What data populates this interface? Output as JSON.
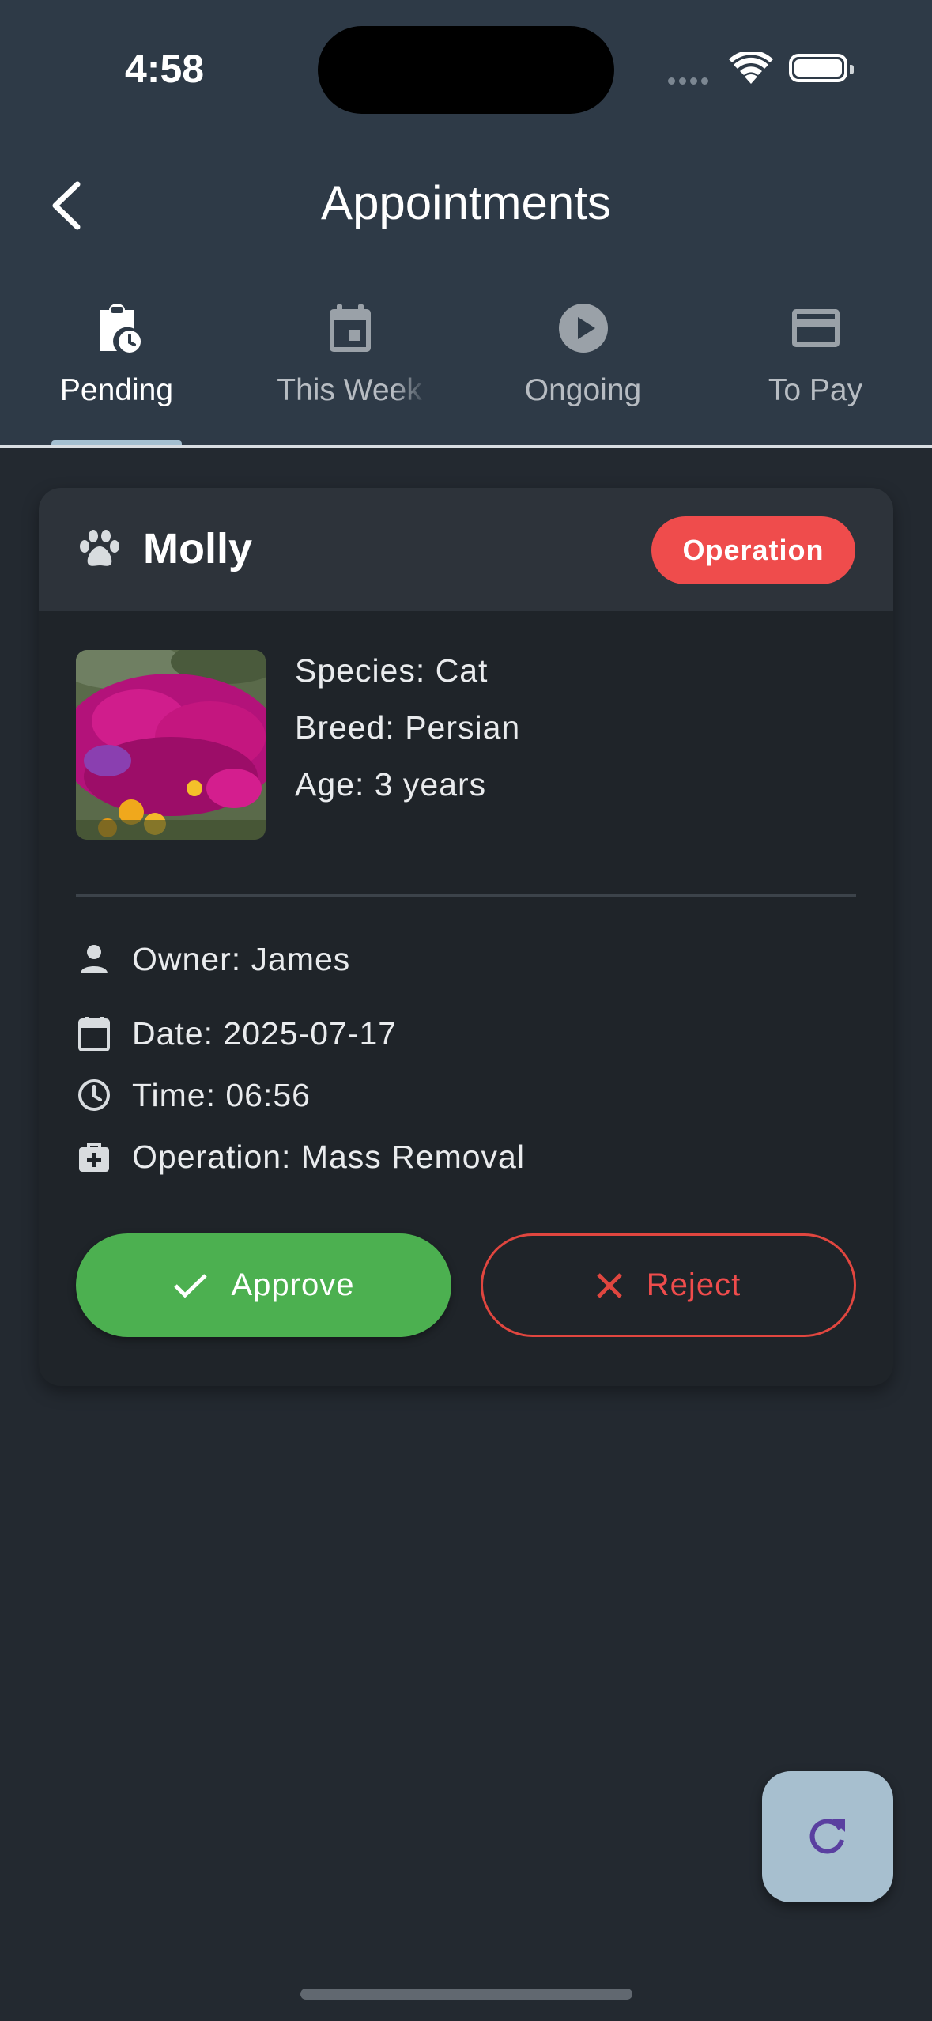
{
  "status_bar": {
    "time": "4:58"
  },
  "header": {
    "title": "Appointments"
  },
  "tabs": [
    {
      "label": "Pending",
      "icon": "clipboard-clock-icon",
      "active": true
    },
    {
      "label": "This Week",
      "icon": "calendar-icon",
      "active": false
    },
    {
      "label": "Ongoing",
      "icon": "play-circle-icon",
      "active": false
    },
    {
      "label": "To Pay",
      "icon": "credit-card-icon",
      "active": false
    }
  ],
  "appointment": {
    "pet_name": "Molly",
    "type_badge": "Operation",
    "species": "Species: Cat",
    "breed": "Breed: Persian",
    "age": "Age: 3 years",
    "owner": "Owner: James",
    "date": "Date: 2025-07-17",
    "time": "Time: 06:56",
    "operation": "Operation: Mass Removal",
    "approve_label": "Approve",
    "reject_label": "Reject"
  },
  "colors": {
    "header_bg": "#2e3a47",
    "page_bg": "#232930",
    "badge": "#ef4c4c",
    "approve": "#4cb050",
    "reject": "#e0463f",
    "fab": "#a7bfcf",
    "fab_icon": "#5a3fa0"
  }
}
